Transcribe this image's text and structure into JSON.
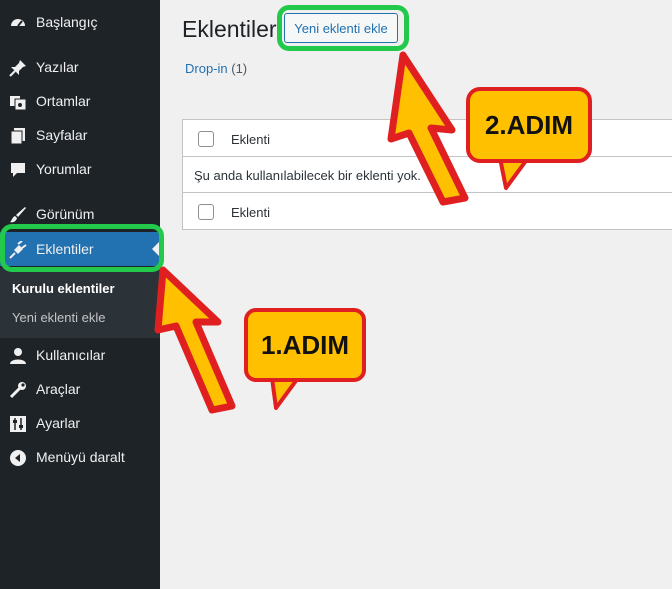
{
  "sidebar": {
    "items": [
      {
        "label": "Başlangıç",
        "icon": "dashboard-icon"
      },
      {
        "label": "Yazılar",
        "icon": "pin-icon"
      },
      {
        "label": "Ortamlar",
        "icon": "media-icon"
      },
      {
        "label": "Sayfalar",
        "icon": "pages-icon"
      },
      {
        "label": "Yorumlar",
        "icon": "comments-icon"
      },
      {
        "label": "Görünüm",
        "icon": "appearance-icon"
      },
      {
        "label": "Eklentiler",
        "icon": "plugins-icon",
        "active": true
      },
      {
        "label": "Kullanıcılar",
        "icon": "users-icon"
      },
      {
        "label": "Araçlar",
        "icon": "tools-icon"
      },
      {
        "label": "Ayarlar",
        "icon": "settings-icon"
      },
      {
        "label": "Menüyü daralt",
        "icon": "collapse-icon"
      }
    ],
    "submenu": [
      {
        "label": "Kurulu eklentiler",
        "current": true
      },
      {
        "label": "Yeni eklenti ekle"
      }
    ]
  },
  "main": {
    "title": "Eklentiler",
    "add_new_label": "Yeni eklenti ekle",
    "filter": {
      "label": "Drop-in",
      "count": "(1)"
    },
    "table": {
      "column_header": "Eklenti",
      "empty_message": "Şu anda kullanılabilecek bir eklenti yok.",
      "column_footer": "Eklenti"
    }
  },
  "annotations": {
    "step1": "1.ADIM",
    "step2": "2.ADIM"
  },
  "colors": {
    "sidebar_bg": "#1d2327",
    "active_bg": "#2271b1",
    "highlight": "#22c94a",
    "callout_fill": "#ffc000",
    "callout_border": "#e02020"
  }
}
